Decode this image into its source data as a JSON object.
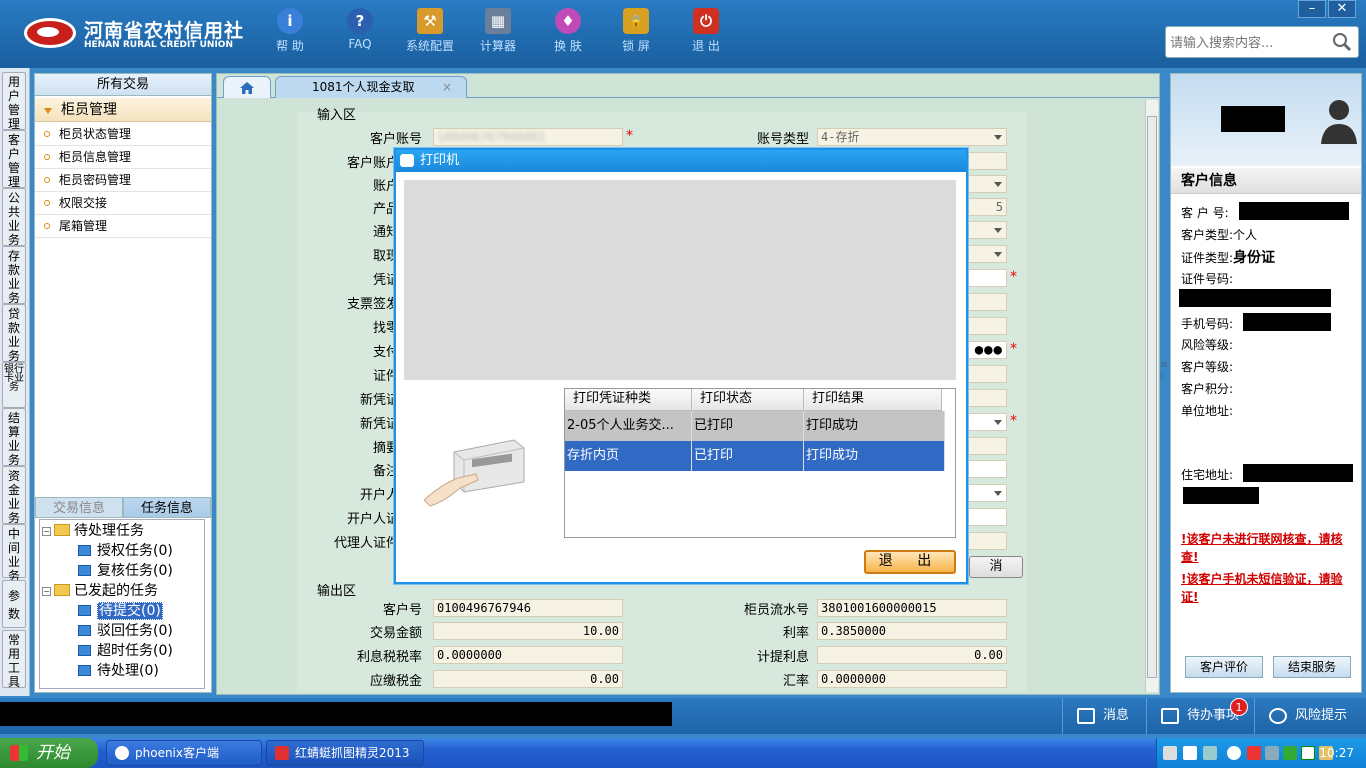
{
  "brand": {
    "name_cn": "河南省农村信用社",
    "name_en": "HENAN RURAL CREDIT UNION"
  },
  "toolbar": [
    {
      "label": "帮 助",
      "icon": "info-icon",
      "glyph": "i",
      "color": "#3a7fd8"
    },
    {
      "label": "FAQ",
      "icon": "question-icon",
      "glyph": "?",
      "color": "#2b5fb0"
    },
    {
      "label": "系统配置",
      "icon": "toolbox-icon",
      "glyph": "⚒",
      "color": "#d79a2b"
    },
    {
      "label": "计算器",
      "icon": "calculator-icon",
      "glyph": "▦",
      "color": "#6a7f9a"
    },
    {
      "label": "换 肤",
      "icon": "shirt-icon",
      "glyph": "♦",
      "color": "#c04ab8"
    },
    {
      "label": "锁 屏",
      "icon": "lock-icon",
      "glyph": "🔒",
      "color": "#d8a020"
    },
    {
      "label": "退 出",
      "icon": "power-icon",
      "glyph": "⏻",
      "color": "#d03020"
    }
  ],
  "window_controls": {
    "minimize": "–",
    "close": "✕"
  },
  "search": {
    "placeholder": "请输入搜索内容...",
    "icon": "magnifier-icon"
  },
  "vnav": [
    "用户管理",
    "客户管理",
    "公共业务",
    "存款业务",
    "贷款业务",
    "银行卡业务",
    "结算业务",
    "资金业务",
    "中间业务",
    "参数",
    "常用工具"
  ],
  "left_panel": {
    "header": "所有交易",
    "group": "柜员管理",
    "items": [
      "柜员状态管理",
      "柜员信息管理",
      "柜员密码管理",
      "权限交接",
      "尾箱管理"
    ],
    "tabs": [
      "交易信息",
      "任务信息"
    ],
    "tree": {
      "pending": "待处理任务",
      "pending_children": [
        "授权任务(0)",
        "复核任务(0)"
      ],
      "initiated": "已发起的任务",
      "initiated_children": [
        "待提交(0)",
        "驳回任务(0)",
        "超时任务(0)",
        "待处理(0)"
      ]
    }
  },
  "tabs": {
    "active": "1081个人现金支取",
    "close": "×"
  },
  "form": {
    "input_section": "输入区",
    "output_section": "输出区",
    "left_labels": [
      "客户账号",
      "客户账户",
      "账户",
      "产品",
      "通知",
      "取现",
      "凭证",
      "支票签发",
      "找零",
      "支付",
      "证件",
      "新凭证",
      "新凭证",
      "摘要",
      "备注",
      "开户人",
      "开户人证",
      "代理人证件"
    ],
    "acct_type_label": "账号类型",
    "acct_type_value": "4-存折",
    "product_suffix": "5",
    "password_mask": "●●●",
    "output_left": [
      {
        "label": "客户号",
        "value": "0100496767946"
      },
      {
        "label": "交易金额",
        "value": "10.00"
      },
      {
        "label": "利息税税率",
        "value": "0.0000000"
      },
      {
        "label": "应缴税金",
        "value": "0.00"
      }
    ],
    "output_right": [
      {
        "label": "柜员流水号",
        "value": "3801001600000015"
      },
      {
        "label": "利率",
        "value": "0.3850000"
      },
      {
        "label": "计提利息",
        "value": "0.00"
      },
      {
        "label": "汇率",
        "value": "0.0000000"
      }
    ],
    "cancel_partial": "消"
  },
  "dialog": {
    "title": "打印机",
    "columns": [
      "打印凭证种类",
      "打印状态",
      "打印结果"
    ],
    "rows": [
      [
        "2-05个人业务交...",
        "已打印",
        "打印成功"
      ],
      [
        "存折内页",
        "已打印",
        "打印成功"
      ]
    ],
    "exit": "退 出"
  },
  "right_panel": {
    "title": "客户信息",
    "cust_no_label": "客 户 号:",
    "cust_type_label": "客户类型:",
    "cust_type_value": "个人",
    "id_type_label": "证件类型:",
    "id_type_value": "身份证",
    "id_no_label": "证件号码:",
    "phone_label": "手机号码:",
    "risk_label": "风险等级:",
    "level_label": "客户等级:",
    "points_label": "客户积分:",
    "company_addr_label": "单位地址:",
    "home_addr_label": "住宅地址:",
    "warn1": "!该客户未进行联网核查，请核查!",
    "warn2": "!该客户手机未短信验证，请验证!",
    "btn_eval": "客户评价",
    "btn_end": "结束服务"
  },
  "statusbar": {
    "messages": "消息",
    "todo": "待办事项",
    "todo_count": "1",
    "risk": "风险提示"
  },
  "taskbar": {
    "start": "开始",
    "tasks": [
      "phoenix客户端",
      "红蜻蜓抓图精灵2013"
    ],
    "clock": "10:27"
  },
  "colors": {
    "header": "#1f6aad",
    "form_bg": "#cfe3d6",
    "selected_row": "#316ac5",
    "warning": "#d00000"
  }
}
